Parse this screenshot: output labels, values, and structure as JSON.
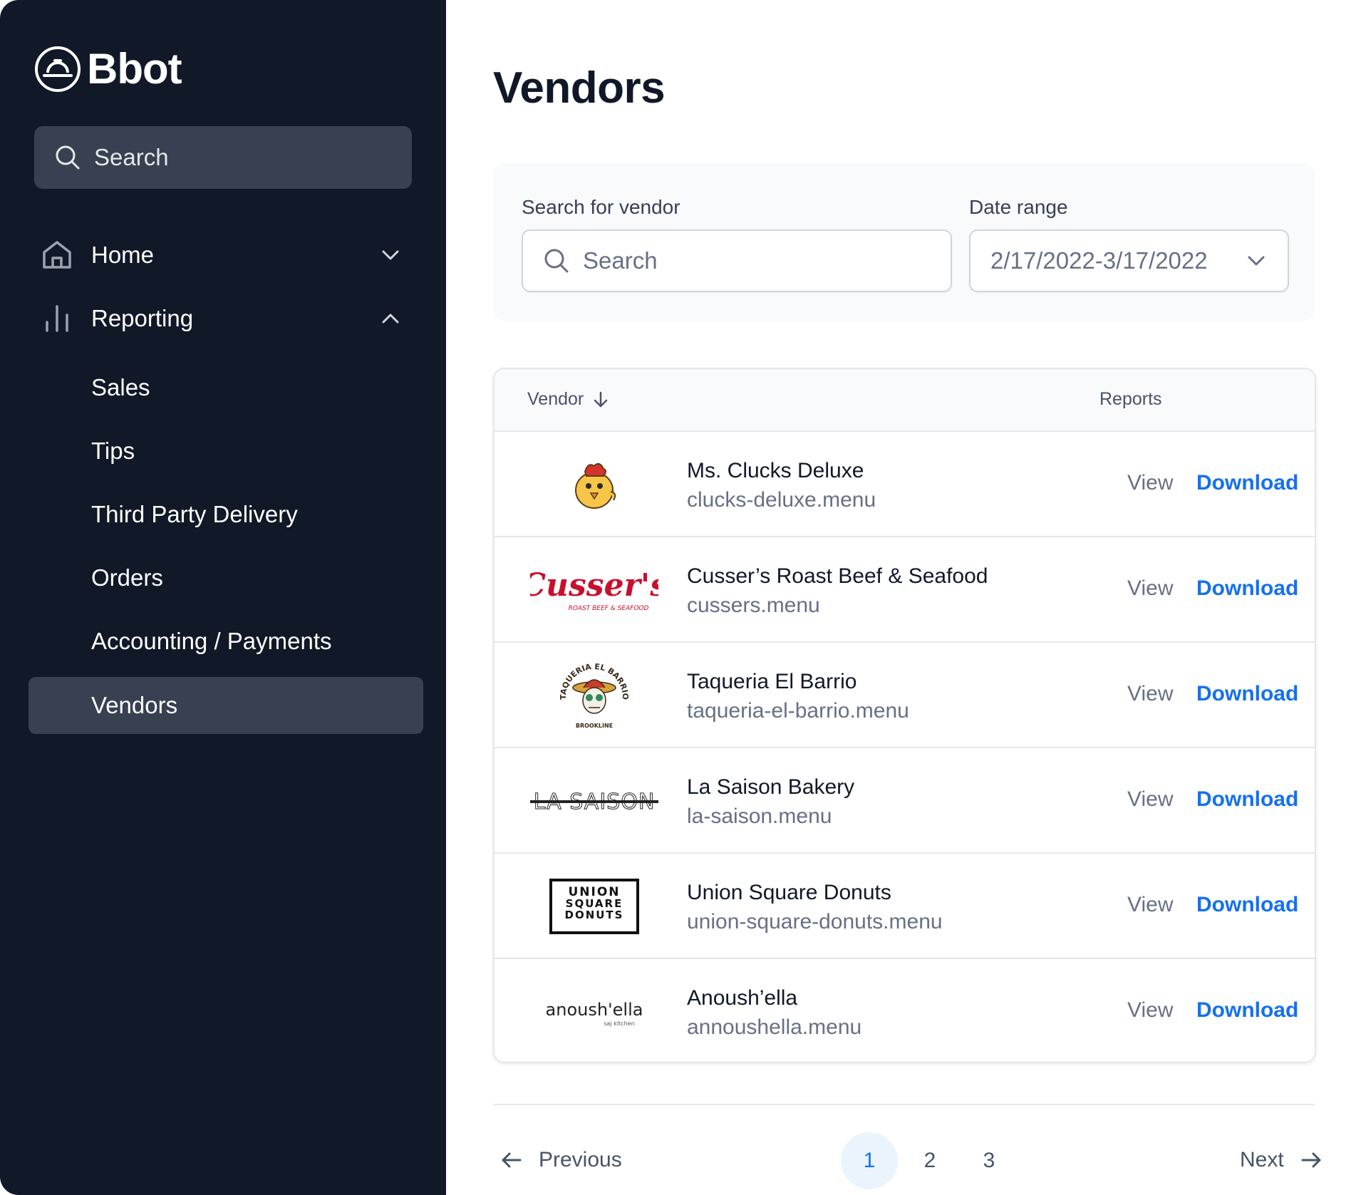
{
  "app": {
    "name": "Bbot"
  },
  "sidebar": {
    "search_placeholder": "Search",
    "nav": [
      {
        "label": "Home",
        "icon": "home-icon",
        "expanded": false
      },
      {
        "label": "Reporting",
        "icon": "bar-chart-icon",
        "expanded": true
      }
    ],
    "reporting_items": [
      {
        "label": "Sales"
      },
      {
        "label": "Tips"
      },
      {
        "label": "Third Party Delivery"
      },
      {
        "label": "Orders"
      },
      {
        "label": "Accounting / Payments"
      },
      {
        "label": "Vendors",
        "active": true
      }
    ]
  },
  "main": {
    "title": "Vendors",
    "filters": {
      "search_label": "Search for vendor",
      "search_placeholder": "Search",
      "date_label": "Date range",
      "date_value": "2/17/2022-3/17/2022"
    },
    "table": {
      "columns": {
        "vendor": "Vendor",
        "reports": "Reports"
      },
      "rows": [
        {
          "name": "Ms. Clucks Deluxe",
          "domain": "clucks-deluxe.menu",
          "view": "View",
          "download": "Download",
          "logo": "chicken-mascot-logo"
        },
        {
          "name": "Cusser’s Roast Beef & Seafood",
          "domain": "cussers.menu",
          "view": "View",
          "download": "Download",
          "logo": "cussers-script-logo",
          "logo_text": "Cusser's",
          "logo_sub": "ROAST BEEF & SEAFOOD"
        },
        {
          "name": "Taqueria El Barrio",
          "domain": "taqueria-el-barrio.menu",
          "view": "View",
          "download": "Download",
          "logo": "sugar-skull-logo",
          "logo_text": "TAQUERIA EL BARRIO",
          "logo_sub": "BROOKLINE"
        },
        {
          "name": "La Saison Bakery",
          "domain": "la-saison.menu",
          "view": "View",
          "download": "Download",
          "logo": "la-saison-logo",
          "logo_text": "LA SAISON"
        },
        {
          "name": "Union Square Donuts",
          "domain": "union-square-donuts.menu",
          "view": "View",
          "download": "Download",
          "logo": "union-square-donuts-logo",
          "logo_text": "UNION SQUARE DONUTS"
        },
        {
          "name": "Anoush’ella",
          "domain": "annoushella.menu",
          "view": "View",
          "download": "Download",
          "logo": "anoushella-logo",
          "logo_text": "anoush'ella",
          "logo_sub": "saj kitchen"
        }
      ]
    },
    "pagination": {
      "previous": "Previous",
      "next": "Next",
      "pages": [
        "1",
        "2",
        "3"
      ],
      "current": "1"
    }
  },
  "colors": {
    "sidebar_bg": "#111827",
    "active_nav": "#374151",
    "link_blue": "#1570ef",
    "active_page_bg": "#eaf4fd"
  }
}
